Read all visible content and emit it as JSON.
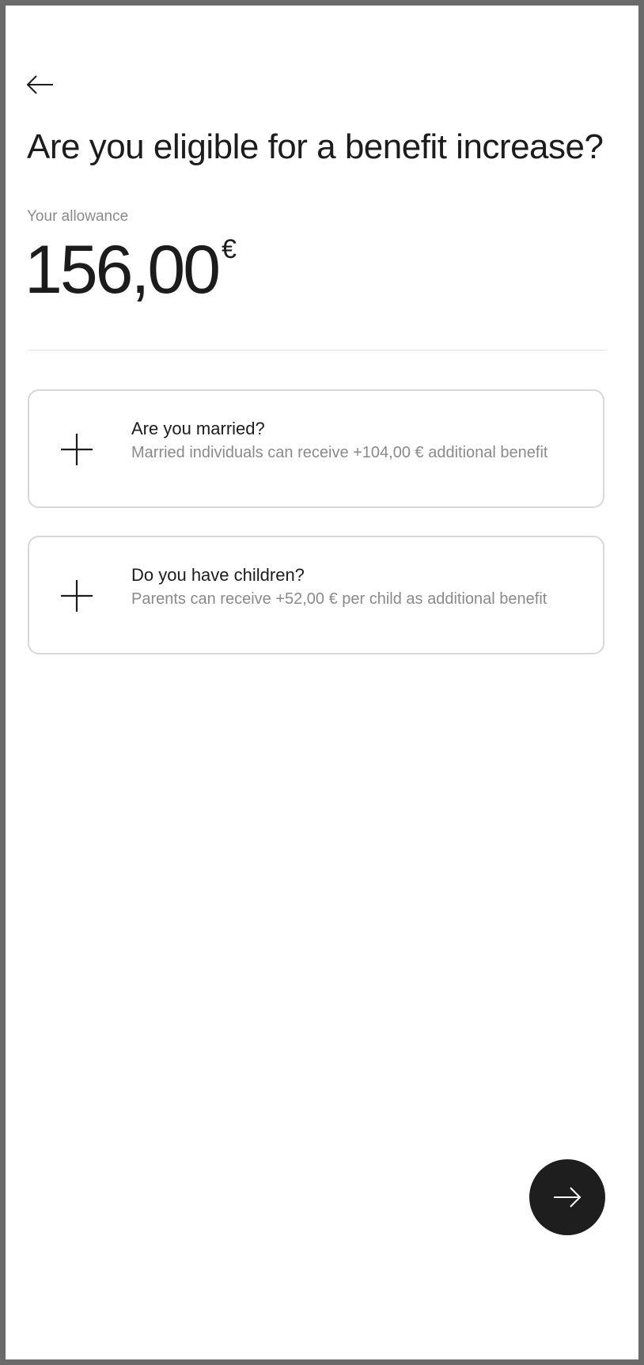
{
  "header": {
    "back_icon": "arrow-left-icon",
    "title": "Are you eligible for a benefit increase?"
  },
  "allowance": {
    "label": "Your allowance",
    "value": "156,00",
    "currency": "€"
  },
  "options": [
    {
      "icon": "plus-icon",
      "title": "Are you married?",
      "description": "Married individuals can receive +104,00 € additional benefit"
    },
    {
      "icon": "plus-icon",
      "title": "Do you have children?",
      "description": "Parents can receive +52,00 € per child as additional benefit"
    }
  ],
  "footer": {
    "next_icon": "arrow-right-icon"
  },
  "colors": {
    "text_primary": "#1c1c1c",
    "text_secondary": "#8a8a8a",
    "card_border": "#d8d8d8",
    "button_bg": "#1e1e1e"
  }
}
